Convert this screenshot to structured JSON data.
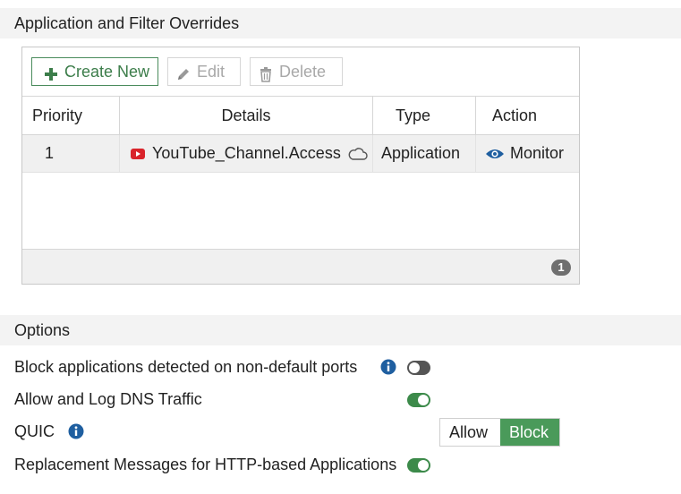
{
  "sections": {
    "overrides_title": "Application and Filter Overrides",
    "options_title": "Options"
  },
  "toolbar": {
    "create_label": "Create New",
    "edit_label": "Edit",
    "delete_label": "Delete"
  },
  "table": {
    "columns": [
      "Priority",
      "Details",
      "Type",
      "Action"
    ],
    "rows": [
      {
        "priority": "1",
        "details": "YouTube_Channel.Access",
        "type": "Application",
        "action": "Monitor"
      }
    ],
    "count": "1"
  },
  "options": {
    "block_non_default": {
      "label": "Block applications detected on non-default ports",
      "enabled": false
    },
    "allow_log_dns": {
      "label": "Allow and Log DNS Traffic",
      "enabled": true
    },
    "quic": {
      "label": "QUIC",
      "choices": [
        "Allow",
        "Block"
      ],
      "selected": "Block"
    },
    "replacement_messages": {
      "label": "Replacement Messages for HTTP-based Applications",
      "enabled": true
    }
  },
  "colors": {
    "accent_green": "#3c8a4a",
    "info_blue": "#1f5fa0",
    "youtube_red": "#d9232a"
  }
}
